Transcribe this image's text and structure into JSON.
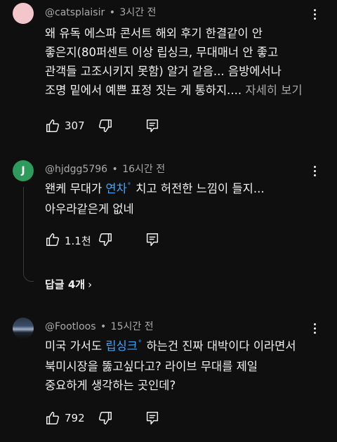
{
  "comments": [
    {
      "author": "@catsplaisir",
      "sep": "•",
      "time": "3시간 전",
      "lines": [
        "왜 유독 에스파 콘서트 해외 후기 한결같이 안",
        "좋은지(80퍼센트 이상 립싱크, 무대매너 안 좋고",
        "관객들 고조시키지 못함) 알거 같음... 음방에서나",
        "조명 밑에서 예쁜 표정 짓는 게 통하지...."
      ],
      "more": "자세히 보기",
      "likes": "307"
    },
    {
      "author": "@hjdgg5796",
      "sep": "•",
      "time": "16시간 전",
      "avatar_letter": "J",
      "line1_pre": "왠케 무대가 ",
      "line1_link": "연차",
      "line1_post": " 치고 허전한 느낌이 들지...",
      "line2": "아우라같은게 없네",
      "likes": "1.1천",
      "replies": "답글 4개"
    },
    {
      "author": "@Footloos",
      "sep": "•",
      "time": "15시간 전",
      "line1_pre": "미국 가서도 ",
      "line1_link": "립싱크",
      "line1_post": " 하는건 진짜 대박이다 이라면서",
      "line2": "북미시장을 뚫고싶다고? 라이브 무대를 제일",
      "line3": "중요하게 생각하는 곳인데?",
      "likes": "792"
    }
  ],
  "search_glyph": "ᐤ",
  "reply_chevron": "›",
  "colors": {
    "background": "#0f0f0f",
    "text": "#f1f1f1",
    "secondary": "#aaaaaa",
    "link": "#3ea6ff"
  }
}
